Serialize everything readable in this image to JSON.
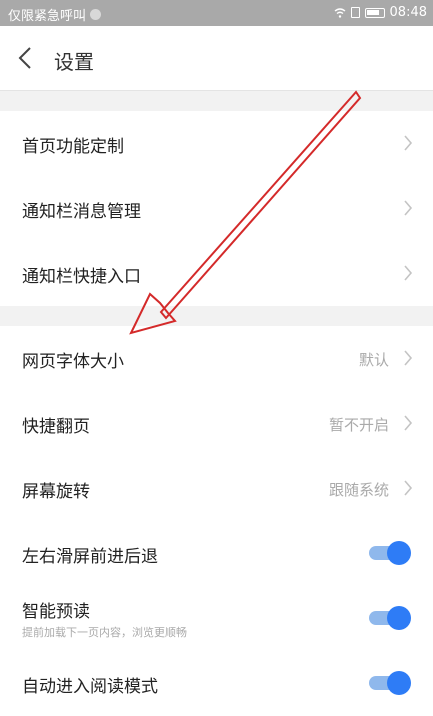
{
  "status_bar": {
    "left_text": "仅限紧急呼叫",
    "time": "08:48"
  },
  "header": {
    "title": "设置"
  },
  "settings": {
    "homepage_custom": {
      "label": "首页功能定制"
    },
    "notif_msg": {
      "label": "通知栏消息管理"
    },
    "notif_shortcut": {
      "label": "通知栏快捷入口"
    },
    "font_size": {
      "label": "网页字体大小",
      "value": "默认"
    },
    "quick_page": {
      "label": "快捷翻页",
      "value": "暂不开启"
    },
    "rotation": {
      "label": "屏幕旋转",
      "value": "跟随系统"
    },
    "swipe_nav": {
      "label": "左右滑屏前进后退",
      "toggle_on": true
    },
    "preread": {
      "label": "智能预读",
      "sub": "提前加载下一页内容，浏览更顺畅",
      "toggle_on": true
    },
    "auto_reader": {
      "label": "自动进入阅读模式",
      "toggle_on": true
    }
  },
  "colors": {
    "accent": "#2e7cf6",
    "annotation_arrow": "#d42a2a"
  }
}
